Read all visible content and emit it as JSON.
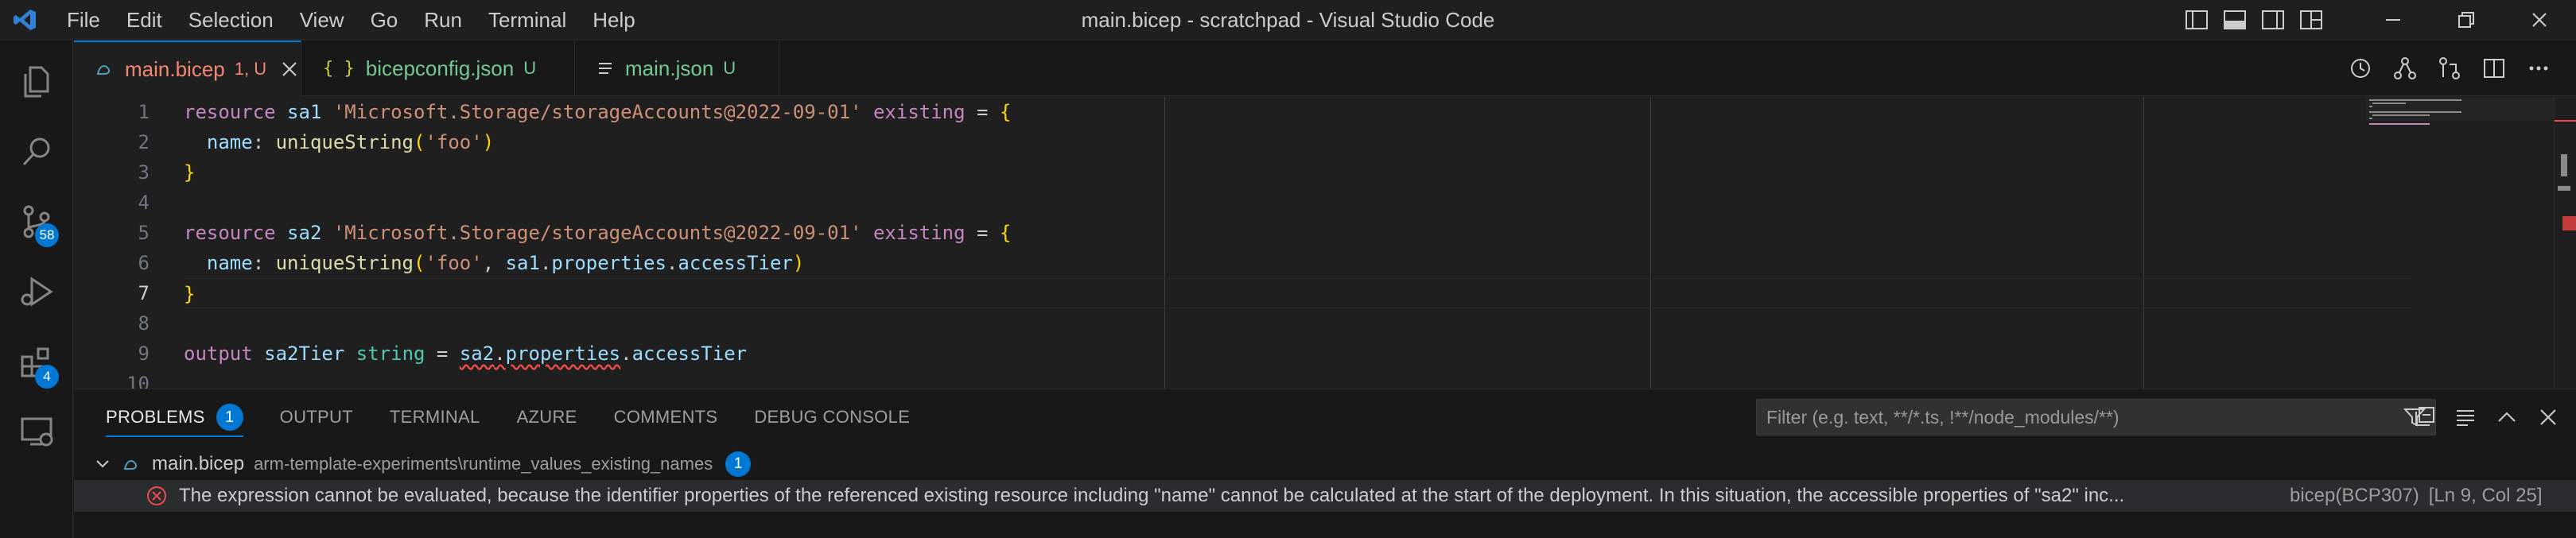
{
  "window": {
    "title": "main.bicep - scratchpad - Visual Studio Code",
    "menu": [
      "File",
      "Edit",
      "Selection",
      "View",
      "Go",
      "Run",
      "Terminal",
      "Help"
    ]
  },
  "activity": {
    "source_control_badge": "58",
    "extensions_badge": "4"
  },
  "tabs": [
    {
      "label": "main.bicep",
      "status": "1, U",
      "icon": "bicep-file-icon",
      "active": true
    },
    {
      "label": "bicepconfig.json",
      "status": "U",
      "icon_text": "{ }",
      "active": false
    },
    {
      "label": "main.json",
      "status": "U",
      "icon": "lines-icon",
      "active": false
    }
  ],
  "editor": {
    "line_numbers": [
      "1",
      "2",
      "3",
      "4",
      "5",
      "6",
      "7",
      "8",
      "9",
      "10"
    ],
    "current_line": "7",
    "lines": [
      "resource sa1 'Microsoft.Storage/storageAccounts@2022-09-01' existing = {",
      "  name: uniqueString('foo')",
      "}",
      "",
      "resource sa2 'Microsoft.Storage/storageAccounts@2022-09-01' existing = {",
      "  name: uniqueString('foo', sa1.properties.accessTier)",
      "}",
      "",
      "output sa2Tier string = sa2.properties.accessTier",
      ""
    ]
  },
  "panel": {
    "tabs": [
      "PROBLEMS",
      "OUTPUT",
      "TERMINAL",
      "AZURE",
      "COMMENTS",
      "DEBUG CONSOLE"
    ],
    "active_tab": "PROBLEMS",
    "problems_count": "1",
    "filter_placeholder": "Filter (e.g. text, **/*.ts, !**/node_modules/**)",
    "file": {
      "name": "main.bicep",
      "path": "arm-template-experiments\\runtime_values_existing_names",
      "count": "1"
    },
    "error": {
      "message": "The expression cannot be evaluated, because the identifier properties of the referenced existing resource including \"name\" cannot be calculated at the start of the deployment. In this situation, the accessible properties of \"sa2\" inc...",
      "source": "bicep(BCP307)",
      "location": "[Ln 9, Col 25]"
    }
  },
  "colors": {
    "accent": "#0078d4",
    "error": "#f14c4c",
    "modified_tab": "#f48771",
    "untracked_tab": "#73c991"
  }
}
